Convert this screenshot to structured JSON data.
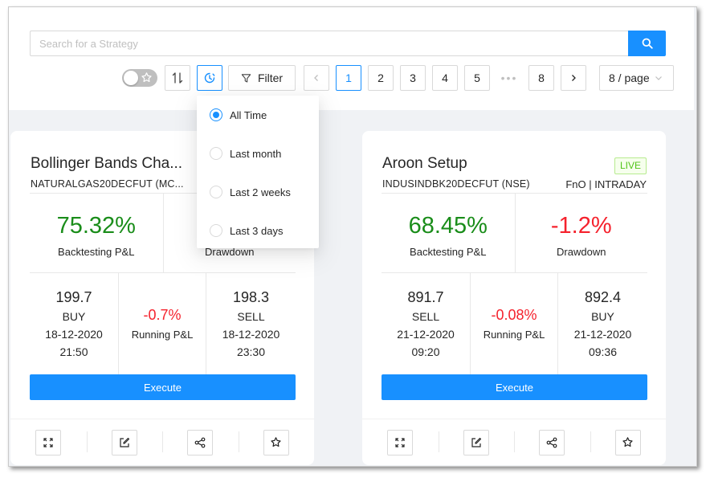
{
  "search": {
    "placeholder": "Search for a Strategy"
  },
  "toolbar": {
    "filter_label": "Filter",
    "pagination": {
      "pages": [
        "1",
        "2",
        "3",
        "4",
        "5"
      ],
      "ellipsis": "•••",
      "last_page": "8",
      "current": "1",
      "page_size": "8 / page"
    }
  },
  "time_filter_menu": {
    "options": [
      "All Time",
      "Last month",
      "Last 2 weeks",
      "Last 3 days"
    ],
    "selected": "All Time"
  },
  "cards": [
    {
      "title": "Bollinger Bands Cha...",
      "symbol": "NATURALGAS20DECFUT (MC...",
      "backtesting_pnl": "75.32%",
      "backtesting_label": "Backtesting P&L",
      "drawdown_label": "Drawdown",
      "entry": {
        "price": "199.7",
        "side": "BUY",
        "date": "18-12-2020",
        "time": "21:50"
      },
      "running_pnl": "-0.7%",
      "running_label": "Running P&L",
      "exit": {
        "price": "198.3",
        "side": "SELL",
        "date": "18-12-2020",
        "time": "23:30"
      },
      "execute_label": "Execute"
    },
    {
      "title": "Aroon Setup",
      "badge": "LIVE",
      "symbol": "INDUSINDBK20DECFUT (NSE)",
      "segment": "FnO | INTRADAY",
      "backtesting_pnl": "68.45%",
      "backtesting_label": "Backtesting P&L",
      "drawdown": "-1.2%",
      "drawdown_label": "Drawdown",
      "entry": {
        "price": "891.7",
        "side": "SELL",
        "date": "21-12-2020",
        "time": "09:20"
      },
      "running_pnl": "-0.08%",
      "running_label": "Running P&L",
      "exit": {
        "price": "892.4",
        "side": "BUY",
        "date": "21-12-2020",
        "time": "09:36"
      },
      "execute_label": "Execute"
    }
  ],
  "colors": {
    "accent": "#1890ff",
    "positive": "#1a8d1a",
    "negative": "#f5222d",
    "live": "#52c41a"
  },
  "icons": [
    "search-icon",
    "star-icon",
    "sort-icon",
    "history-icon",
    "filter-icon",
    "chevron-left-icon",
    "chevron-right-icon",
    "chevron-down-icon",
    "expand-icon",
    "edit-icon",
    "share-icon"
  ]
}
